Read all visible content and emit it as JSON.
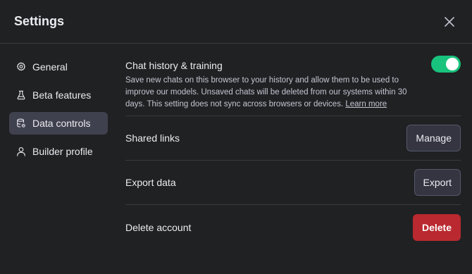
{
  "dialog": {
    "title": "Settings",
    "close_icon": "close-icon"
  },
  "sidebar": {
    "items": [
      {
        "label": "General",
        "icon": "gear-icon",
        "active": false
      },
      {
        "label": "Beta features",
        "icon": "flask-icon",
        "active": false
      },
      {
        "label": "Data controls",
        "icon": "database-gear-icon",
        "active": true
      },
      {
        "label": "Builder profile",
        "icon": "user-icon",
        "active": false
      }
    ]
  },
  "data_controls": {
    "chat_history": {
      "title": "Chat history & training",
      "description": "Save new chats on this browser to your history and allow them to be used to improve our models. Unsaved chats will be deleted from our systems within 30 days. This setting does not sync across browsers or devices.",
      "link_text": "Learn more",
      "enabled": true
    },
    "shared_links": {
      "label": "Shared links",
      "button": "Manage"
    },
    "export_data": {
      "label": "Export data",
      "button": "Export"
    },
    "delete_account": {
      "label": "Delete account",
      "button": "Delete"
    }
  },
  "colors": {
    "background": "#202123",
    "toggle_on": "#19c37d",
    "danger": "#b9292f",
    "active_nav": "#40414f"
  }
}
